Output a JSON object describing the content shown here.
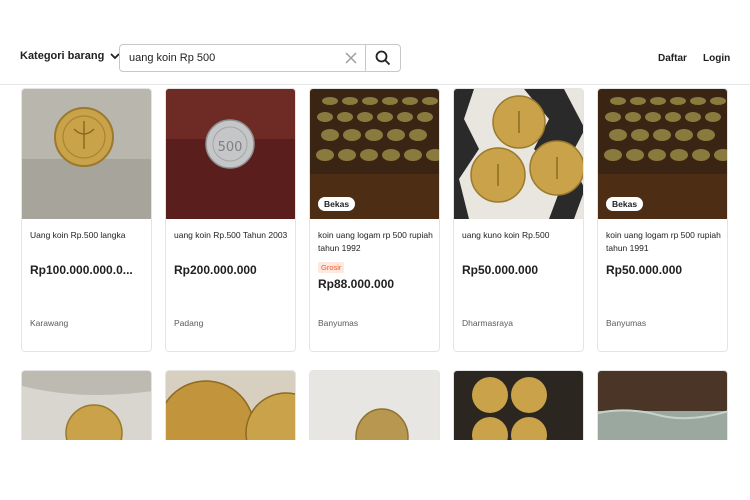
{
  "header": {
    "category_label": "Kategori barang",
    "search_value": "uang koin Rp 500",
    "signup_label": "Daftar",
    "login_label": "Login"
  },
  "listings": [
    {
      "title": "Uang koin Rp.500 langka",
      "price": "Rp100.000.000.0...",
      "location": "Karawang",
      "badge": "",
      "tag": ""
    },
    {
      "title": "uang koin Rp.500 Tahun 2003",
      "price": "Rp200.000.000",
      "location": "Padang",
      "badge": "",
      "tag": ""
    },
    {
      "title": "koin uang logam rp 500 rupiah tahun 1992",
      "price": "Rp88.000.000",
      "location": "Banyumas",
      "badge": "Bekas",
      "tag": "Grosir"
    },
    {
      "title": "uang kuno koin Rp.500",
      "price": "Rp50.000.000",
      "location": "Dharmasraya",
      "badge": "",
      "tag": ""
    },
    {
      "title": "koin uang logam rp 500 rupiah tahun 1991",
      "price": "Rp50.000.000",
      "location": "Banyumas",
      "badge": "Bekas",
      "tag": ""
    }
  ],
  "icons": {
    "chevron": "chevron-down-icon",
    "clear": "close-icon",
    "search": "search-icon"
  },
  "colors": {
    "grosir_text": "#f05a28",
    "grosir_bg": "#fde9df",
    "coin_gold": "#c9a24a"
  }
}
